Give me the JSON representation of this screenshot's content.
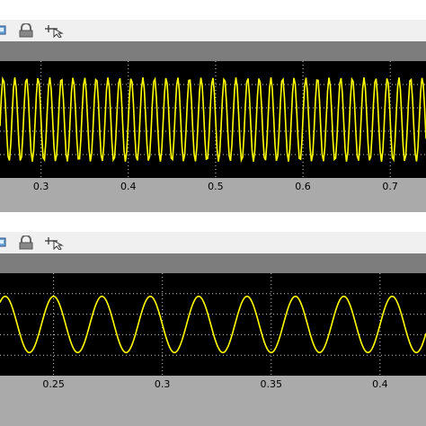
{
  "colors": {
    "trace": "#ffff00",
    "grid": "#ffffff",
    "plot_bg": "#000000",
    "frame": "#aaaaaa",
    "toolbar": "#f0f0f0"
  },
  "scopes": [
    {
      "toolbar_icons": [
        "print-icon",
        "lock-icon",
        "cursor-icon"
      ],
      "chart_data": {
        "type": "line",
        "series": [
          {
            "waveform": "sine",
            "color": "#ffff00"
          }
        ],
        "x_ticks": [
          "0.3",
          "0.4",
          "0.5",
          "0.6",
          "0.7"
        ],
        "xlim": [
          0.253,
          0.741
        ],
        "cycles_per_0_1": 7.5,
        "y_amplitude_of_half_range": 0.72,
        "grid": true
      }
    },
    {
      "toolbar_icons": [
        "print-icon",
        "lock-icon",
        "cursor-icon"
      ],
      "chart_data": {
        "type": "line",
        "series": [
          {
            "waveform": "sine",
            "color": "#ffff00"
          }
        ],
        "x_ticks": [
          "0.25",
          "0.3",
          "0.35",
          "0.4"
        ],
        "xlim": [
          0.2254,
          0.4211
        ],
        "cycles_per_0_1": 4.5,
        "y_amplitude_of_half_range": 0.55,
        "grid": true
      }
    }
  ]
}
